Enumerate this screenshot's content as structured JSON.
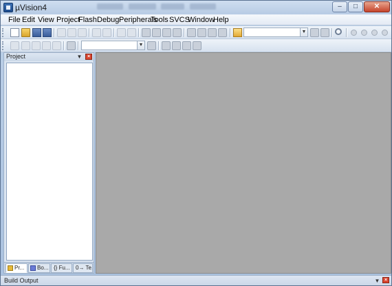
{
  "window": {
    "title": "µVision4"
  },
  "menubar": {
    "items": [
      "File",
      "Edit",
      "View",
      "Project",
      "Flash",
      "Debug",
      "Peripherals",
      "Tools",
      "SVCS",
      "Window",
      "Help"
    ]
  },
  "project_pane": {
    "title": "Project",
    "tabs": [
      "Pr...",
      "Bo...",
      "{} Fu...",
      "0→ Te..."
    ]
  },
  "build_output": {
    "title": "Build Output"
  },
  "toolbar": {
    "target_combo_value": "",
    "find_combo_value": ""
  },
  "colors": {
    "editor_background": "#a9a9a9",
    "close_button": "#c5432b"
  }
}
